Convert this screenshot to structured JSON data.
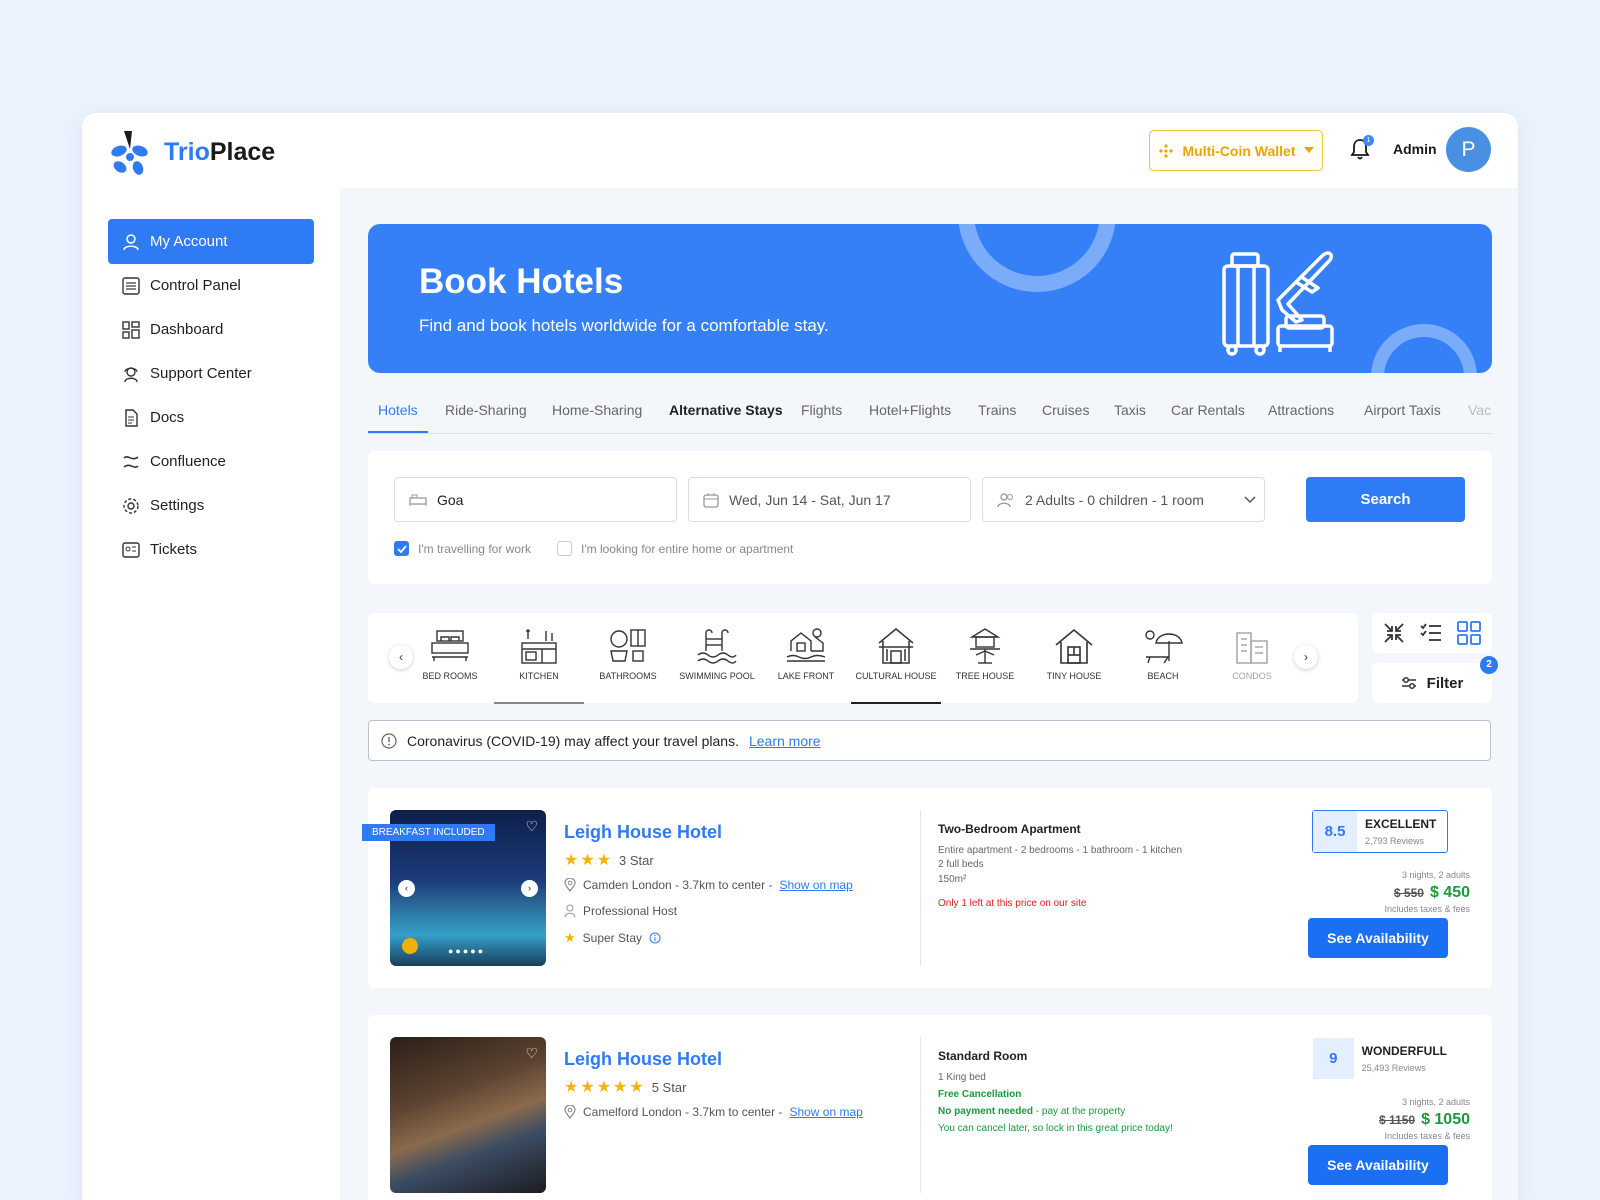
{
  "brand": {
    "name_part1": "Trio",
    "name_part2": "Place"
  },
  "header": {
    "wallet_label": "Multi-Coin Wallet",
    "notification_count": "1",
    "user_name": "Admin",
    "avatar_initial": "P"
  },
  "sidebar": {
    "items": [
      {
        "label": "My Account",
        "icon": "user-icon"
      },
      {
        "label": "Control Panel",
        "icon": "sliders-icon"
      },
      {
        "label": "Dashboard",
        "icon": "grid-icon"
      },
      {
        "label": "Support Center",
        "icon": "support-agent-icon"
      },
      {
        "label": "Docs",
        "icon": "document-icon"
      },
      {
        "label": "Confluence",
        "icon": "confluence-icon"
      },
      {
        "label": "Settings",
        "icon": "gear-icon"
      },
      {
        "label": "Tickets",
        "icon": "ticket-icon"
      }
    ]
  },
  "banner": {
    "title": "Book Hotels",
    "subtitle": "Find and book hotels worldwide for a comfortable stay."
  },
  "tabs": [
    "Hotels",
    "Ride-Sharing",
    "Home-Sharing",
    "Alternative Stays",
    "Flights",
    "Hotel+Flights",
    "Trains",
    "Cruises",
    "Taxis",
    "Car Rentals",
    "Attractions",
    "Airport Taxis",
    "Vac"
  ],
  "search": {
    "destination": "Goa",
    "dates": "Wed, Jun 14 - Sat, Jun 17",
    "guests": "2 Adults - 0 children - 1 room",
    "button": "Search",
    "check_work": "I'm travelling for work",
    "check_home": "I'm looking for entire home or apartment"
  },
  "categories": [
    "BED ROOMS",
    "KITCHEN",
    "BATHROOMS",
    "SWIMMING POOL",
    "LAKE FRONT",
    "CULTURAL HOUSE",
    "TREE HOUSE",
    "TINY HOUSE",
    "BEACH",
    "CONDOS"
  ],
  "filter": {
    "label": "Filter",
    "count": "2"
  },
  "covid": {
    "text": "Coronavirus (COVID-19) may affect your travel plans.",
    "link": "Learn more"
  },
  "hotels": [
    {
      "ribbon": "BREAKFAST INCLUDED",
      "name": "Leigh House Hotel",
      "stars": "★★★",
      "star_label": "3 Star",
      "location": "Camden London - 3.7km to center -",
      "map_link": "Show on map",
      "host": "Professional Host",
      "super": "Super Stay",
      "room": "Two-Bedroom Apartment",
      "details": [
        "Entire apartment - 2 bedrooms - 1 bathroom - 1 kitchen",
        "2 full beds",
        "150m²"
      ],
      "alert": "Only 1 left at this price on our site",
      "score": "8.5",
      "rating": "EXCELLENT",
      "reviews": "2,793 Reviews",
      "nights": "3 nights, 2 adults",
      "old_price": "$ 550",
      "price": "$ 450",
      "taxes": "Includes taxes & fees",
      "button": "See Availability"
    },
    {
      "name": "Leigh House Hotel",
      "stars": "★★★★★",
      "star_label": "5 Star",
      "location": "Camelford London - 3.7km to center -",
      "map_link": "Show on map",
      "room": "Standard Room",
      "details": [
        "1 King bed"
      ],
      "free": "Free Cancellation",
      "payment": "No payment needed",
      "payment_note": " - pay at the property",
      "cancel_note": "You can cancel later, so lock in this great price today!",
      "score": "9",
      "rating": "WONDERFULL",
      "reviews": "25,493 Reviews",
      "nights": "3 nights, 2 adults",
      "old_price": "$ 1150",
      "price": "$ 1050",
      "taxes": "Includes taxes & fees",
      "button": "See Availability"
    }
  ],
  "colors": {
    "accent": "#2f7bf5",
    "wallet": "#e8a600",
    "price": "#1a9a3c",
    "alert": "#e02020"
  }
}
